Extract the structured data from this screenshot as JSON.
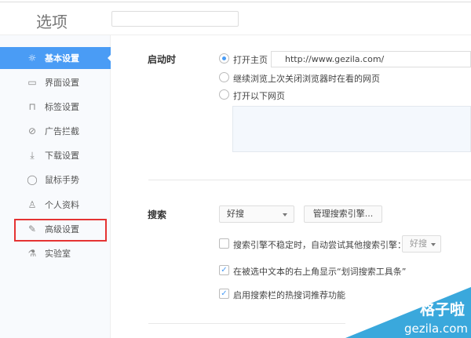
{
  "header": {
    "title": "选项",
    "search_placeholder": ""
  },
  "sidebar": {
    "items": [
      {
        "label": "基本设置",
        "icon": "sun-icon",
        "glyph": "☼"
      },
      {
        "label": "界面设置",
        "icon": "window-icon",
        "glyph": "▭"
      },
      {
        "label": "标签设置",
        "icon": "tab-icon",
        "glyph": "⊓"
      },
      {
        "label": "广告拦截",
        "icon": "block-icon",
        "glyph": "⊘"
      },
      {
        "label": "下载设置",
        "icon": "download-icon",
        "glyph": "⤓"
      },
      {
        "label": "鼠标手势",
        "icon": "mouse-icon",
        "glyph": "◯"
      },
      {
        "label": "个人资料",
        "icon": "user-icon",
        "glyph": "♙"
      },
      {
        "label": "高级设置",
        "icon": "wrench-icon",
        "glyph": "✎"
      },
      {
        "label": "实验室",
        "icon": "flask-icon",
        "glyph": "⚗"
      }
    ]
  },
  "startup": {
    "label": "启动时",
    "options": [
      "打开主页",
      "继续浏览上次关闭浏览器时在看的网页",
      "打开以下网页"
    ],
    "homepage": "http://www.gezila.com/"
  },
  "search": {
    "label": "搜索",
    "engine": "好搜",
    "manage_button": "管理搜索引擎...",
    "checks": [
      {
        "label": "搜索引擎不稳定时，自动尝试其他搜索引擎：",
        "checked": false,
        "fallback": "好搜"
      },
      {
        "label": "在被选中文本的右上角显示“划词搜索工具条”",
        "checked": true
      },
      {
        "label": "启用搜索栏的热搜词推荐功能",
        "checked": true
      }
    ]
  },
  "watermark": {
    "line1": "格子啦",
    "line2": "gezila.com"
  }
}
